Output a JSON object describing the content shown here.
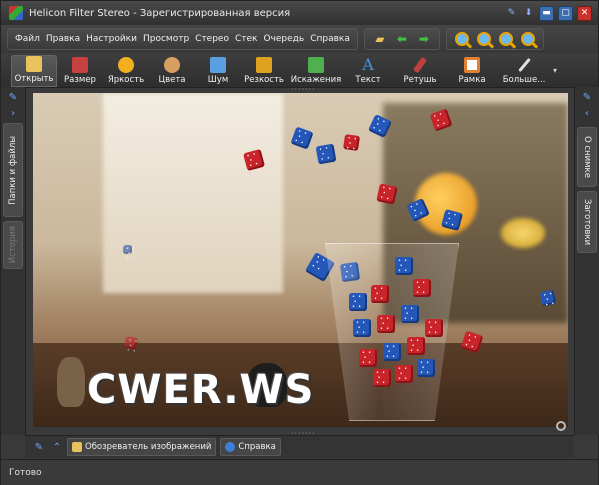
{
  "window": {
    "title": "Helicon Filter Stereo - Зарегистрированная версия"
  },
  "menu": {
    "items": [
      "Файл",
      "Правка",
      "Настройки",
      "Просмотр",
      "Стерео",
      "Стек",
      "Очередь",
      "Справка"
    ]
  },
  "ribbon": {
    "tools": [
      {
        "label": "Открыть",
        "icon": "open-icon",
        "color": "#e8c25a"
      },
      {
        "label": "Размер",
        "icon": "scissors-icon",
        "color": "#c84040"
      },
      {
        "label": "Яркость",
        "icon": "sun-icon",
        "color": "#f0b020"
      },
      {
        "label": "Цвета",
        "icon": "palette-icon",
        "color": "#d8a060"
      },
      {
        "label": "Шум",
        "icon": "noise-icon",
        "color": "#5aa0e0"
      },
      {
        "label": "Резкость",
        "icon": "sharpen-icon",
        "color": "#e0a020"
      },
      {
        "label": "Искажения",
        "icon": "distort-icon",
        "color": "#50b050"
      },
      {
        "label": "Текст",
        "icon": "text-icon",
        "color": "#4a90e0"
      },
      {
        "label": "Ретушь",
        "icon": "brush-icon",
        "color": "#c04040"
      },
      {
        "label": "Рамка",
        "icon": "frame-icon",
        "color": "#e08030"
      },
      {
        "label": "Больше...",
        "icon": "wand-icon",
        "color": "#e0e0e0"
      }
    ]
  },
  "left_panel": {
    "tabs": [
      "Папки и файлы",
      "История"
    ]
  },
  "right_panel": {
    "tabs": [
      "О снимке",
      "Заготовки"
    ]
  },
  "viewer": {
    "watermark": "CWER.WS"
  },
  "bottom_panel": {
    "tabs": [
      "Обозреватель изображений",
      "Справка"
    ]
  },
  "status": {
    "text": "Готово"
  }
}
